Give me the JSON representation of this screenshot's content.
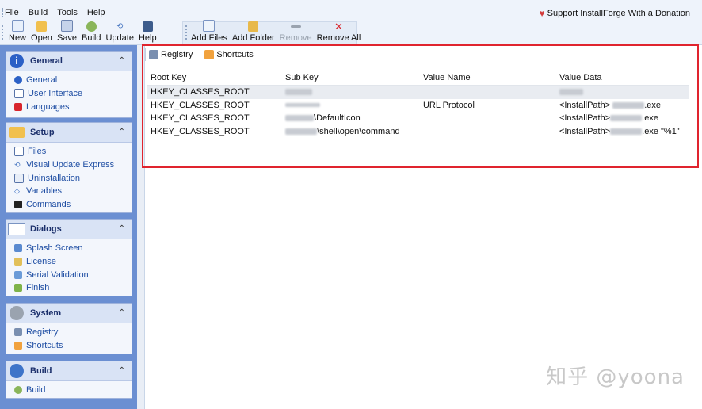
{
  "menu": [
    "File",
    "Build",
    "Tools",
    "Help"
  ],
  "donation_text": "Support InstallForge With a Donation",
  "toolbar": {
    "new_label": "New",
    "open_label": "Open",
    "save_label": "Save",
    "build_label": "Build",
    "update_label": "Update",
    "help_label": "Help",
    "add_files_label": "Add Files",
    "add_folder_label": "Add Folder",
    "remove_label": "Remove",
    "remove_all_label": "Remove All"
  },
  "sidebar": {
    "general": {
      "title": "General",
      "items": [
        "General",
        "User Interface",
        "Languages"
      ]
    },
    "setup": {
      "title": "Setup",
      "items": [
        "Files",
        "Visual Update Express",
        "Uninstallation",
        "Variables",
        "Commands"
      ]
    },
    "dialogs": {
      "title": "Dialogs",
      "items": [
        "Splash Screen",
        "License",
        "Serial Validation",
        "Finish"
      ]
    },
    "system": {
      "title": "System",
      "items": [
        "Registry",
        "Shortcuts"
      ]
    },
    "build": {
      "title": "Build",
      "items": [
        "Build"
      ]
    }
  },
  "tabs": [
    "Registry",
    "Shortcuts"
  ],
  "table": {
    "columns": [
      "Root Key",
      "Sub Key",
      "Value Name",
      "Value Data"
    ],
    "rows": [
      {
        "root": "HKEY_CLASSES_ROOT",
        "sub": "",
        "name": "",
        "data": ""
      },
      {
        "root": "HKEY_CLASSES_ROOT",
        "sub": "",
        "name": "URL Protocol",
        "data_prefix": "<InstallPath>",
        "data_suffix": ".exe"
      },
      {
        "root": "HKEY_CLASSES_ROOT",
        "sub": "\\DefaultIcon",
        "name": "",
        "data_prefix": "<InstallPath>",
        "data_suffix": ".exe"
      },
      {
        "root": "HKEY_CLASSES_ROOT",
        "sub": "\\shell\\open\\command",
        "name": "",
        "data_prefix": "<InstallPath>",
        "data_suffix": ".exe \"%1\""
      }
    ]
  },
  "watermark": "知乎 @yoona",
  "colors": {
    "sidebar_bg": "#6b8fd2",
    "highlight_border": "#e0242e",
    "link_text": "#1f4ea3"
  }
}
